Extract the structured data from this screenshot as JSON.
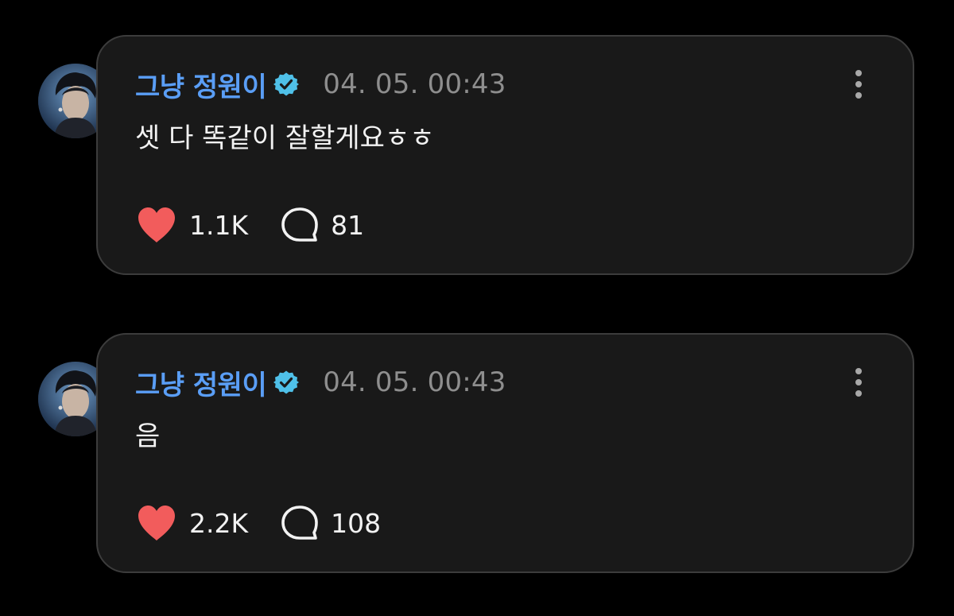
{
  "posts": [
    {
      "author": "그냥 정원이",
      "timestamp": "04. 05. 00:43",
      "text": "셋 다 똑같이 잘할게요ㅎㅎ",
      "likes": "1.1K",
      "comments": "81"
    },
    {
      "author": "그냥 정원이",
      "timestamp": "04. 05. 00:43",
      "text": "음",
      "likes": "2.2K",
      "comments": "108"
    }
  ],
  "icons": {
    "like": "heart-icon",
    "comment": "speech-bubble-icon",
    "more": "vertical-ellipsis-icon",
    "verified": "verified-badge-icon"
  },
  "colors": {
    "background": "#000000",
    "card": "#191919",
    "card_border": "#3c3c3c",
    "author": "#5a9ef6",
    "verified_badge": "#4fc0e8",
    "timestamp": "#8e8e8e",
    "heart": "#f25c5c",
    "text": "#f2f2f2"
  }
}
